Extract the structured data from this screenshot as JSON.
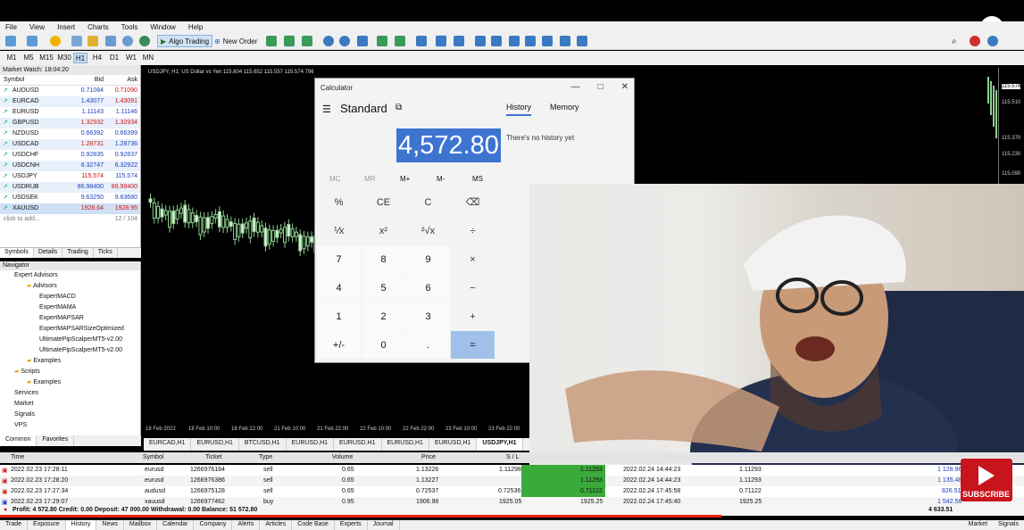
{
  "menu": [
    "File",
    "View",
    "Insert",
    "Charts",
    "Tools",
    "Window",
    "Help"
  ],
  "toolbar": {
    "algo_trading": "Algo Trading",
    "new_order": "New Order"
  },
  "timeframes": [
    "M1",
    "M5",
    "M15",
    "M30",
    "H1",
    "H4",
    "D1",
    "W1",
    "MN"
  ],
  "active_timeframe": "H1",
  "market_watch": {
    "title": "Market Watch: 18:04:20",
    "columns": [
      "Symbol",
      "Bid",
      "Ask"
    ],
    "rows": [
      [
        "AUDUSD",
        "0.71084",
        "0.71090"
      ],
      [
        "EURCAD",
        "1.43077",
        "1.43091"
      ],
      [
        "EURUSD",
        "1.11143",
        "1.11146"
      ],
      [
        "GBPUSD",
        "1.32932",
        "1.32934"
      ],
      [
        "NZDUSD",
        "0.66392",
        "0.66399"
      ],
      [
        "USDCAD",
        "1.28731",
        "1.28736"
      ],
      [
        "USDCHF",
        "0.92835",
        "0.92837"
      ],
      [
        "USDCNH",
        "6.32747",
        "6.32922"
      ],
      [
        "USDJPY",
        "115.574",
        "115.574"
      ],
      [
        "USDRUB",
        "86.98400",
        "86.99400"
      ],
      [
        "USDSEK",
        "9.63250",
        "9.63680"
      ],
      [
        "XAUUSD",
        "1928.64",
        "1928.95"
      ]
    ],
    "add_label": "click to add...",
    "count": "12 / 104",
    "tabs": [
      "Symbols",
      "Details",
      "Trading",
      "Ticks"
    ]
  },
  "navigator": {
    "title": "Navigator",
    "items": [
      "Expert Advisors",
      "Advisors",
      "ExpertMACD",
      "ExpertMAMA",
      "ExpertMAPSAR",
      "ExpertMAPSARSizeOptimized",
      "UltimatePipScalperMT5-v2.00",
      "UltimatePipScalperMT5-v2.00",
      "Examples",
      "Scripts",
      "Examples",
      "Services",
      "Market",
      "Signals",
      "VPS"
    ],
    "tabs": [
      "Common",
      "Favorites"
    ]
  },
  "chart": {
    "title": "USDJPY, H1: US Dollar vs Yen  115.604 115.652 115.557 115.574  796",
    "price_labels": [
      "115.574",
      "115.510",
      "115.370",
      "115.230",
      "115.090"
    ],
    "time_labels": [
      "18 Feb 2022",
      "18 Feb 10:00",
      "18 Feb 22:00",
      "21 Feb 10:00",
      "21 Feb 22:00",
      "22 Feb 10:00",
      "22 Feb 22:00",
      "23 Feb 10:00",
      "23 Feb 22:00"
    ],
    "tabs": [
      "EURCAD,H1",
      "EURUSD,H1",
      "BTCUSD,H1",
      "EURUSD,H1",
      "EURUSD,H1",
      "EURUSD,H1",
      "EURUSD,H1",
      "USDJPY,H1"
    ]
  },
  "calculator": {
    "window_title": "Calculator",
    "mode": "Standard",
    "display": "4,572.80",
    "history_tab": "History",
    "memory_tab": "Memory",
    "no_history": "There's no history yet",
    "memory_keys": [
      "MC",
      "MR",
      "M+",
      "M-",
      "MS"
    ],
    "keys": [
      "%",
      "CE",
      "C",
      "⌫",
      "⅟x",
      "x²",
      "²√x",
      "÷",
      "7",
      "8",
      "9",
      "×",
      "4",
      "5",
      "6",
      "−",
      "1",
      "2",
      "3",
      "+",
      "+/-",
      "0",
      ".",
      "="
    ]
  },
  "trades": {
    "columns": [
      "Time",
      "Symbol",
      "Ticket",
      "Type",
      "Volume",
      "Price",
      "S / L"
    ],
    "rows": [
      [
        "2022.02.23 17:28:11",
        "eurusd",
        "1266976184",
        "sell",
        "0.65",
        "1.13226",
        "1.11298",
        "1.11293",
        "2022.02.24 14:44:23",
        "1.11293",
        "1 128.96"
      ],
      [
        "2022.02.23 17:28:20",
        "eurusd",
        "1266976386",
        "sell",
        "0.65",
        "1.13227",
        "",
        "1.11293",
        "2022.02.24 14:44:23",
        "1.11293",
        "1 135.48"
      ],
      [
        "2022.02.23 17:27:34",
        "audusd",
        "1266975128",
        "sell",
        "0.65",
        "0.72537",
        "0.72536",
        "0.71122",
        "2022.02.24 17:45:58",
        "0.71122",
        "826.51"
      ],
      [
        "2022.02.23 17:29:07",
        "xauusd",
        "1266977462",
        "buy",
        "0.95",
        "1906.98",
        "1925.05",
        "1925.25",
        "2022.02.24 17:45:40",
        "1925.25",
        "1 542.56"
      ]
    ],
    "summary": "Profit: 4 572.80  Credit: 0.00  Deposit: 47 000.00  Withdrawal: 0.00  Balance: 51 572.80",
    "total": "4 633.51"
  },
  "bottom_tabs": [
    "Trade",
    "Exposure",
    "History",
    "News",
    "Mailbox",
    "Calendar",
    "Company",
    "Alerts",
    "Articles",
    "Code Base",
    "Experts",
    "Journal"
  ],
  "subscribe_label": "SUBSCRIBE",
  "status": {
    "market": "Market",
    "signals": "Signals"
  }
}
